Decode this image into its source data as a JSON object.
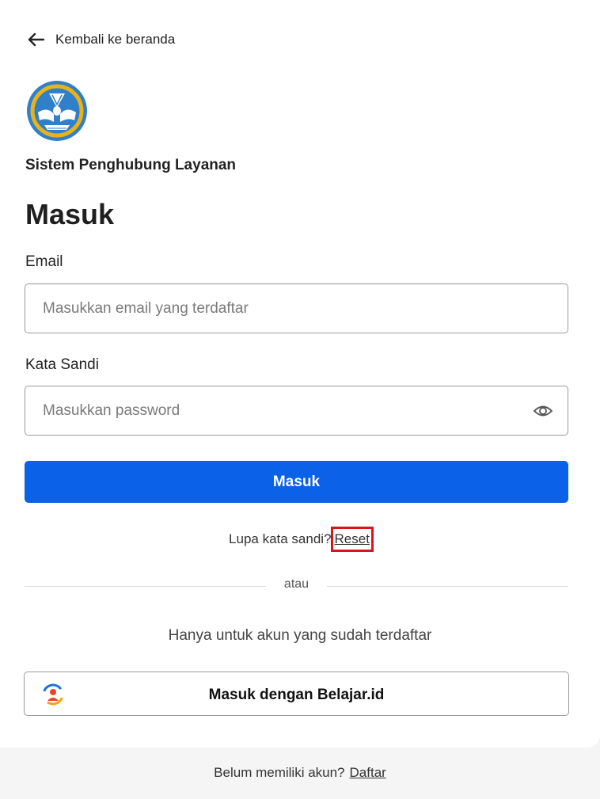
{
  "nav": {
    "back_label": "Kembali ke beranda",
    "back_icon": "arrow-left-icon"
  },
  "brand": {
    "app_name": "Sistem Penghubung Layanan",
    "logo": "tut-wuri-handayani-logo"
  },
  "page": {
    "title": "Masuk"
  },
  "form": {
    "email_label": "Email",
    "email_placeholder": "Masukkan email yang terdaftar",
    "email_value": "",
    "password_label": "Kata Sandi",
    "password_placeholder": "Masukkan password",
    "password_value": "",
    "toggle_icon": "eye-icon",
    "submit_label": "Masuk"
  },
  "forgot": {
    "text": "Lupa kata sandi?",
    "link_label": "Reset"
  },
  "divider": {
    "text": "atau"
  },
  "sso": {
    "note": "Hanya untuk akun yang sudah terdaftar",
    "button_label": "Masuk dengan Belajar.id",
    "icon": "belajar-id-icon"
  },
  "footer": {
    "text": "Belum memiliki akun?",
    "link_label": "Daftar"
  },
  "colors": {
    "primary": "#0b61e8",
    "highlight": "#d9141e",
    "background": "#f5f5f5"
  }
}
